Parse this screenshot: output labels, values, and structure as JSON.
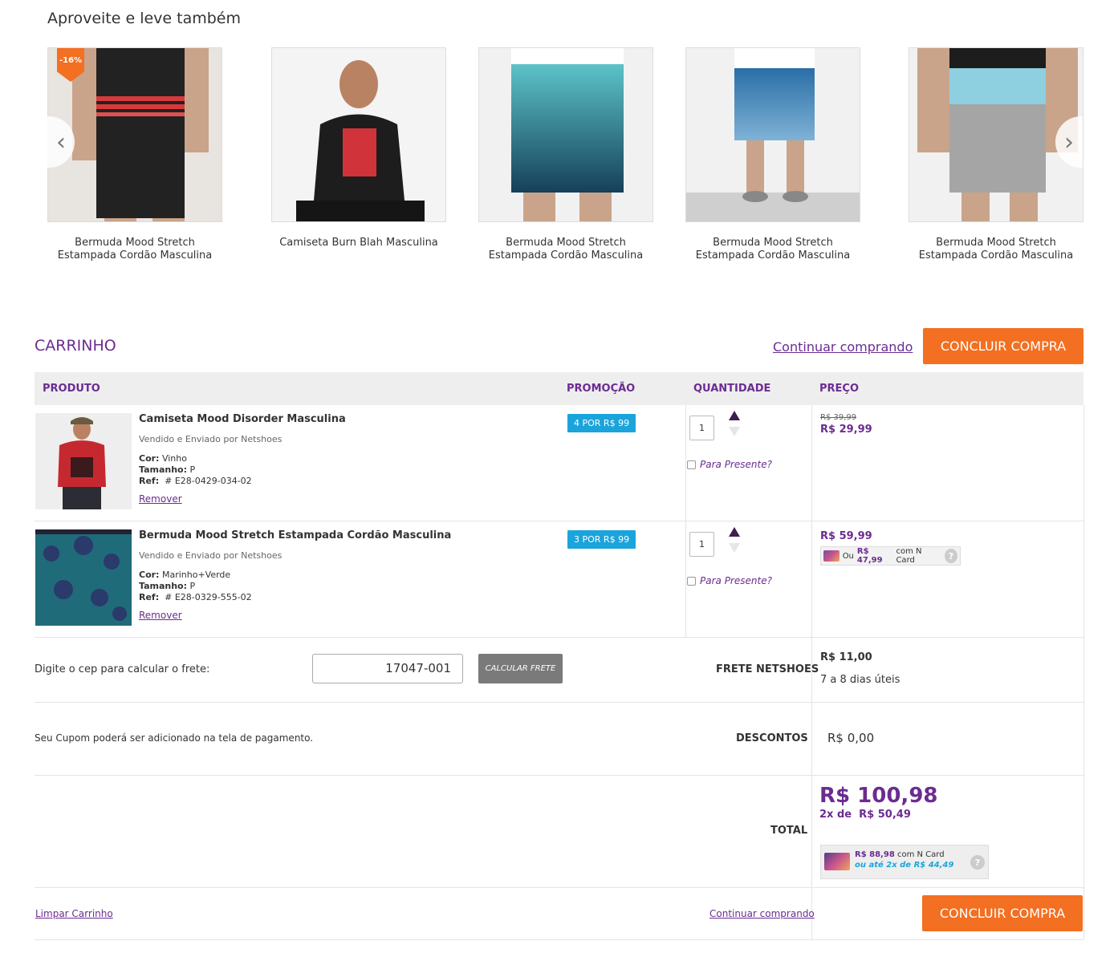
{
  "recommendations": {
    "title": "Aproveite e leve também",
    "items": [
      {
        "name": "Bermuda Mood Stretch\nEstampada Cordão Masculina",
        "discount": "-16%"
      },
      {
        "name": "Camiseta Burn Blah Masculina"
      },
      {
        "name": "Bermuda Mood Stretch\nEstampada Cordão Masculina"
      },
      {
        "name": "Bermuda Mood Stretch\nEstampada Cordão Masculina"
      },
      {
        "name": "Bermuda Mood Stretch\nEstampada Cordão Masculina"
      }
    ],
    "prev_icon": "chevron-left-icon",
    "next_icon": "chevron-right-icon"
  },
  "cart": {
    "title": "CARRINHO",
    "continue_link": "Continuar comprando",
    "checkout_label": "CONCLUIR COMPRA",
    "headers": {
      "product": "PRODUTO",
      "promo": "PROMOÇÃO",
      "qty": "QUANTIDADE",
      "price": "PREÇO"
    },
    "items": [
      {
        "name": "Camiseta Mood Disorder Masculina",
        "seller": "Vendido e Enviado por Netshoes",
        "color_label": "Cor:",
        "color": "Vinho",
        "size_label": "Tamanho:",
        "size": "P",
        "ref_label": "Ref:",
        "ref": "# E28-0429-034-02",
        "remove": "Remover",
        "promo": "4 POR R$ 99",
        "qty": "1",
        "gift": "Para Presente?",
        "old_price": "R$ 39,99",
        "price": "R$ 29,99"
      },
      {
        "name": "Bermuda Mood Stretch Estampada Cordão Masculina",
        "seller": "Vendido e Enviado por Netshoes",
        "color_label": "Cor:",
        "color": "Marinho+Verde",
        "size_label": "Tamanho:",
        "size": "P",
        "ref_label": "Ref:",
        "ref": "# E28-0329-555-02",
        "remove": "Remover",
        "promo": "3 POR R$ 99",
        "qty": "1",
        "gift": "Para Presente?",
        "price": "R$ 59,99",
        "ncard_prefix": "Ou",
        "ncard_price": "R$ 47,99",
        "ncard_suffix": "com N Card"
      }
    ],
    "shipping": {
      "label": "Digite o cep para calcular o frete:",
      "cep": "17047-001",
      "button": "CALCULAR FRETE",
      "method": "FRETE NETSHOES",
      "price": "R$ 11,00",
      "days": "7 a 8 dias úteis"
    },
    "discount": {
      "note": "Seu Cupom poderá ser adicionado na tela de pagamento.",
      "label": "DESCONTOS",
      "value": "R$ 0,00"
    },
    "total": {
      "label": "TOTAL",
      "value": "R$ 100,98",
      "inst_prefix": "2x de",
      "inst_value": "R$ 50,49",
      "ncard_price": "R$ 88,98",
      "ncard_suffix": "com N Card",
      "ncard_inst": "ou até 2x de R$ 44,49"
    },
    "footer": {
      "clear": "Limpar Carrinho",
      "continue": "Continuar comprando",
      "checkout": "CONCLUIR COMPRA"
    }
  },
  "colors": {
    "brand_purple": "#6b2c91",
    "accent_orange": "#f36f21",
    "promo_blue": "#1ba4dc"
  }
}
